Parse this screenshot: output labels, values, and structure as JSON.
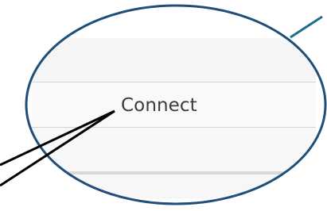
{
  "menu": {
    "items": [
      {
        "label": "Connect"
      }
    ]
  },
  "colors": {
    "callout_ring": "#1f4e79",
    "pointer_line": "#000000"
  }
}
